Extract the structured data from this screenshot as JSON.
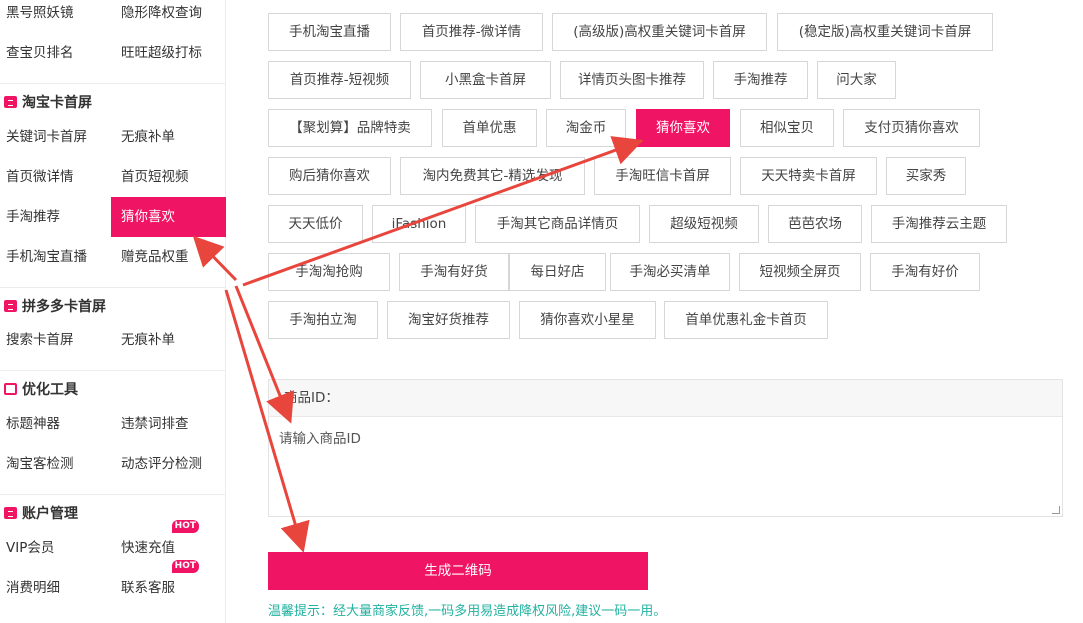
{
  "sidebar": {
    "rows": [
      {
        "a": "黑号照妖镜",
        "b": "隐形降权查询"
      },
      {
        "a": "查宝贝排名",
        "b": "旺旺超级打标"
      }
    ],
    "sections": [
      {
        "title": "淘宝卡首屏",
        "rows": [
          {
            "a": "关键词卡首屏",
            "b": "无痕补单"
          },
          {
            "a": "首页微详情",
            "b": "首页短视频"
          },
          {
            "a": "手淘推荐",
            "b": "猜你喜欢"
          },
          {
            "a": "手机淘宝直播",
            "b": "赠竞品权重"
          }
        ]
      },
      {
        "title": "拼多多卡首屏",
        "rows": [
          {
            "a": "搜索卡首屏",
            "b": "无痕补单"
          }
        ]
      },
      {
        "title": "优化工具",
        "rows": [
          {
            "a": "标题神器",
            "b": "违禁词排查"
          },
          {
            "a": "淘宝客检测",
            "b": "动态评分检测"
          }
        ]
      },
      {
        "title": "账户管理",
        "rows": [
          {
            "a": "VIP会员",
            "b": "快速充值"
          },
          {
            "a": "消费明细",
            "b": "联系客服"
          }
        ]
      }
    ],
    "hot_badge": "HOT"
  },
  "tags": [
    "手机淘宝直播",
    "首页推荐-微详情",
    "(高级版)高权重关键词卡首屏",
    "(稳定版)高权重关键词卡首屏",
    "首页推荐-短视频",
    "小黑盒卡首屏",
    "详情页头图卡推荐",
    "手淘推荐",
    "问大家",
    "【聚划算】品牌特卖",
    "首单优惠",
    "淘金币",
    "猜你喜欢",
    "相似宝贝",
    "支付页猜你喜欢",
    "购后猜你喜欢",
    "淘内免费其它-精选发现",
    "手淘旺信卡首屏",
    "天天特卖卡首屏",
    "买家秀",
    "天天低价",
    "iFashion",
    "手淘其它商品详情页",
    "超级短视频",
    "芭芭农场",
    "手淘推荐云主题",
    "手淘淘抢购",
    "手淘有好货",
    "每日好店",
    "手淘必买清单",
    "短视频全屏页",
    "手淘有好价",
    "手淘拍立淘",
    "淘宝好货推荐",
    "猜你喜欢小星星",
    "首单优惠礼金卡首页"
  ],
  "active_tag": "猜你喜欢",
  "form": {
    "label": "商品ID：",
    "placeholder": "请输入商品ID",
    "button": "生成二维码"
  },
  "tip": "温馨提示：经大量商家反馈,一码多用易造成降权风险,建议一码一用。",
  "colors": {
    "accent": "#f01464",
    "tip": "#22b2a0",
    "annotation_arrow": "#e8453c"
  }
}
